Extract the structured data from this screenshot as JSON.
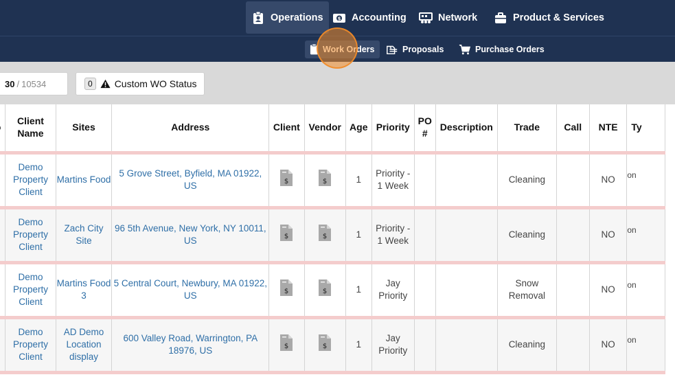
{
  "nav": {
    "items": [
      {
        "label": "Operations",
        "icon": "clipboard-user-icon",
        "active": true
      },
      {
        "label": "Accounting",
        "icon": "money-icon",
        "active": false
      },
      {
        "label": "Network",
        "icon": "network-icon",
        "active": false
      },
      {
        "label": "Product & Services",
        "icon": "briefcase-icon",
        "active": false
      }
    ],
    "sub_items": [
      {
        "label": "Work Orders",
        "icon": "clipboard-icon",
        "active": true
      },
      {
        "label": "Proposals",
        "icon": "proposal-icon",
        "active": false
      },
      {
        "label": "Purchase Orders",
        "icon": "cart-icon",
        "active": false
      }
    ]
  },
  "filters": {
    "pager_current": "30",
    "pager_separator": "/",
    "pager_total": "10534",
    "wo_status_count": "0",
    "wo_status_label": "Custom WO Status"
  },
  "table": {
    "headers": [
      "o",
      "Client Name",
      "Sites",
      "Address",
      "Client",
      "Vendor",
      "Age",
      "Priority",
      "PO #",
      "Description",
      "Trade",
      "Call",
      "NTE",
      "Ty"
    ],
    "rows": [
      {
        "client_name": "Demo Property Client",
        "site": "Martins Food",
        "address": "5 Grove Street, Byfield, MA 01922, US",
        "age": "1",
        "priority": "Priority - 1 Week",
        "po": "",
        "description": "",
        "trade": "Cleaning",
        "call": "",
        "nte": "NO",
        "type": "on"
      },
      {
        "client_name": "Demo Property Client",
        "site": "Zach City Site",
        "address": "96 5th Avenue, New York, NY 10011, US",
        "age": "1",
        "priority": "Priority - 1 Week",
        "po": "",
        "description": "",
        "trade": "Cleaning",
        "call": "",
        "nte": "NO",
        "type": "on"
      },
      {
        "client_name": "Demo Property Client",
        "site": "Martins Food 3",
        "address": "5 Central Court, Newbury, MA 01922, US",
        "age": "1",
        "priority": "Jay Priority",
        "po": "",
        "description": "",
        "trade": "Snow Removal",
        "call": "",
        "nte": "NO",
        "type": "on"
      },
      {
        "client_name": "Demo Property Client",
        "site": "AD Demo Location display",
        "address": "600 Valley Road, Warrington, PA 18976, US",
        "age": "1",
        "priority": "Jay Priority",
        "po": "",
        "description": "",
        "trade": "Cleaning",
        "call": "",
        "nte": "NO",
        "type": "on"
      }
    ]
  },
  "colors": {
    "nav_bg": "#1f3252",
    "nav_active": "#36496a",
    "link": "#2f6fa7",
    "row_separator": "#f4cccc",
    "highlight": "#f28c28"
  }
}
